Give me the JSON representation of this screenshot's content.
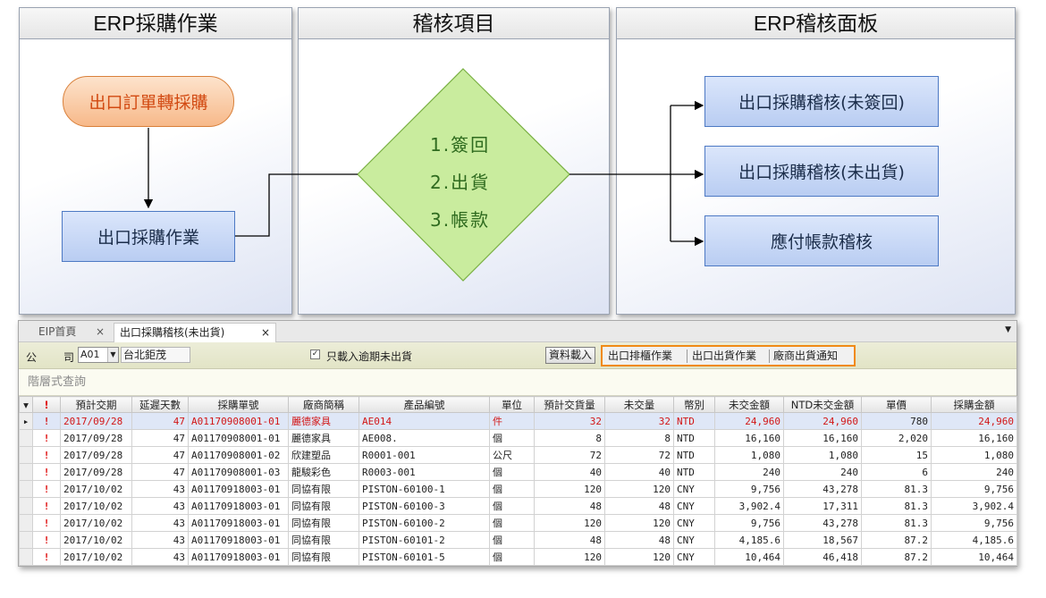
{
  "diagram": {
    "columns": [
      "ERP採購作業",
      "稽核項目",
      "ERP稽核面板"
    ],
    "erp_purchase": {
      "source_node": "出口訂單轉採購",
      "process_node": "出口採購作業"
    },
    "audit_items": [
      "1.簽回",
      "2.出貨",
      "3.帳款"
    ],
    "panel_nodes": [
      "出口採購稽核(未簽回)",
      "出口採購稽核(未出貨)",
      "應付帳款稽核"
    ]
  },
  "app": {
    "tabs": [
      {
        "label": "EIP首頁",
        "close": "×"
      },
      {
        "label": "出口採購稽核(未出貨)",
        "close": "×"
      }
    ],
    "tab_menu_icon": "dropdown-triangle",
    "filter": {
      "company_label_1": "公",
      "company_label_2": "司",
      "company_code": "A01",
      "company_name": "台北鉅茂",
      "only_overdue_checked": true,
      "only_overdue_label": "只載入逾期未出貨",
      "load_button": "資料載入",
      "action_buttons": [
        "出口排櫃作業",
        "出口出貨作業",
        "廠商出貨通知"
      ]
    },
    "hierarchy_query_placeholder": "階層式查詢",
    "grid": {
      "columns": [
        "!",
        "預計交期",
        "延遲天數",
        "採購單號",
        "廠商簡稱",
        "產品編號",
        "單位",
        "預計交貨量",
        "未交量",
        "幣別",
        "未交金額",
        "NTD未交金額",
        "單價",
        "採購金額"
      ],
      "rows": [
        [
          "!",
          "2017/09/28",
          "47",
          "A01170908001-01",
          "麗德家具",
          "AE014",
          "件",
          "32",
          "32",
          "NTD",
          "24,960",
          "24,960",
          "780",
          "24,960"
        ],
        [
          "!",
          "2017/09/28",
          "47",
          "A01170908001-01",
          "麗德家具",
          "AE008.",
          "個",
          "8",
          "8",
          "NTD",
          "16,160",
          "16,160",
          "2,020",
          "16,160"
        ],
        [
          "!",
          "2017/09/28",
          "47",
          "A01170908001-02",
          "欣建塑品",
          "R0001-001",
          "公尺",
          "72",
          "72",
          "NTD",
          "1,080",
          "1,080",
          "15",
          "1,080"
        ],
        [
          "!",
          "2017/09/28",
          "47",
          "A01170908001-03",
          "龍駿彩色",
          "R0003-001",
          "個",
          "40",
          "40",
          "NTD",
          "240",
          "240",
          "6",
          "240"
        ],
        [
          "!",
          "2017/10/02",
          "43",
          "A01170918003-01",
          "同協有限",
          "PISTON-60100-1",
          "個",
          "120",
          "120",
          "CNY",
          "9,756",
          "43,278",
          "81.3",
          "9,756"
        ],
        [
          "!",
          "2017/10/02",
          "43",
          "A01170918003-01",
          "同協有限",
          "PISTON-60100-3",
          "個",
          "48",
          "48",
          "CNY",
          "3,902.4",
          "17,311",
          "81.3",
          "3,902.4"
        ],
        [
          "!",
          "2017/10/02",
          "43",
          "A01170918003-01",
          "同協有限",
          "PISTON-60100-2",
          "個",
          "120",
          "120",
          "CNY",
          "9,756",
          "43,278",
          "81.3",
          "9,756"
        ],
        [
          "!",
          "2017/10/02",
          "43",
          "A01170918003-01",
          "同協有限",
          "PISTON-60101-2",
          "個",
          "48",
          "48",
          "CNY",
          "4,185.6",
          "18,567",
          "87.2",
          "4,185.6"
        ],
        [
          "!",
          "2017/10/02",
          "43",
          "A01170918003-01",
          "同協有限",
          "PISTON-60101-5",
          "個",
          "120",
          "120",
          "CNY",
          "10,464",
          "46,418",
          "87.2",
          "10,464"
        ]
      ],
      "highlighted_row": 0
    },
    "colors": {
      "accent_orange": "#f08a16",
      "overdue_red": "#e01010",
      "highlight_row": "#dfe7f7"
    }
  }
}
